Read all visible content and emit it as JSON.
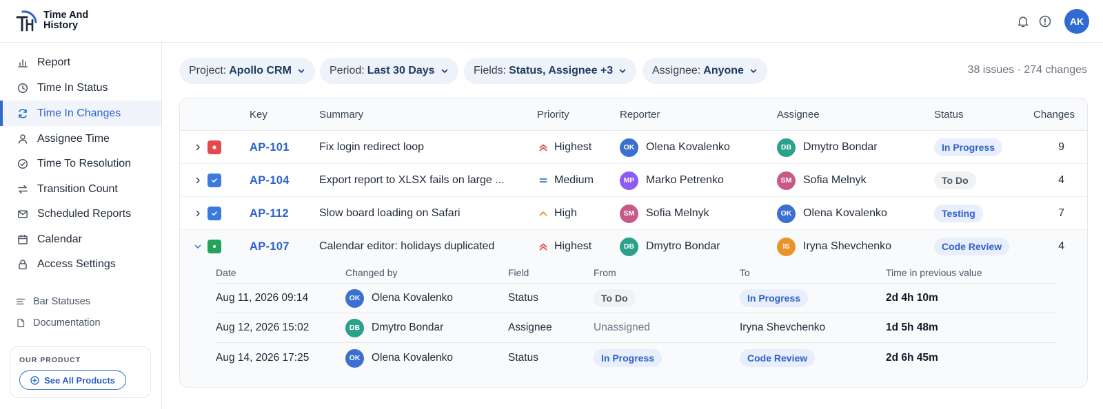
{
  "app": {
    "name": "Time And History",
    "brand_line1": "Time And",
    "brand_line2": "History",
    "user_initials": "AK"
  },
  "sidebar": {
    "items": [
      {
        "label": "Report",
        "icon": "bar-chart-icon"
      },
      {
        "label": "Time In Status",
        "icon": "clock-icon"
      },
      {
        "label": "Time In Changes",
        "icon": "refresh-icon",
        "active": true
      },
      {
        "label": "Assignee Time",
        "icon": "user-icon"
      },
      {
        "label": "Time To Resolution",
        "icon": "check-circle-icon"
      },
      {
        "label": "Transition Count",
        "icon": "swap-arrows-icon"
      },
      {
        "label": "Scheduled Reports",
        "icon": "mail-icon"
      },
      {
        "label": "Calendar",
        "icon": "calendar-icon"
      },
      {
        "label": "Access Settings",
        "icon": "lock-icon"
      }
    ],
    "secondary": [
      {
        "label": "Bar Statuses",
        "icon": "lines-icon"
      },
      {
        "label": "Documentation",
        "icon": "document-icon"
      }
    ],
    "product": {
      "caption": "OUR PRODUCT",
      "button": "See All Products"
    }
  },
  "filters": {
    "project": {
      "label": "Project:",
      "value": "Apollo CRM"
    },
    "period": {
      "label": "Period:",
      "value": "Last 30 Days"
    },
    "fields": {
      "label": "Fields:",
      "value": "Status, Assignee +3"
    },
    "assignee": {
      "label": "Assignee:",
      "value": "Anyone"
    },
    "counts": "38 issues · 274 changes"
  },
  "table": {
    "headers": {
      "key": "Key",
      "summary": "Summary",
      "priority": "Priority",
      "reporter": "Reporter",
      "assignee": "Assignee",
      "status": "Status",
      "changes": "Changes"
    },
    "rows": [
      {
        "type": "bug",
        "key": "AP-101",
        "summary": "Fix login redirect loop",
        "priority": "Highest",
        "reporter": {
          "initials": "OK",
          "name": "Olena Kovalenko"
        },
        "assignee": {
          "initials": "DB",
          "name": "Dmytro Bondar"
        },
        "status": "In Progress",
        "changes": "9"
      },
      {
        "type": "task",
        "key": "AP-104",
        "summary": "Export report to XLSX fails on large ...",
        "priority": "Medium",
        "reporter": {
          "initials": "MP",
          "name": "Marko Petrenko"
        },
        "assignee": {
          "initials": "SM",
          "name": "Sofia Melnyk"
        },
        "status": "To Do",
        "changes": "4"
      },
      {
        "type": "task",
        "key": "AP-112",
        "summary": "Slow board loading on Safari",
        "priority": "High",
        "reporter": {
          "initials": "SM",
          "name": "Sofia Melnyk"
        },
        "assignee": {
          "initials": "OK",
          "name": "Olena Kovalenko"
        },
        "status": "Testing",
        "changes": "7"
      },
      {
        "type": "story",
        "key": "AP-107",
        "summary": "Calendar editor: holidays duplicated",
        "priority": "Highest",
        "reporter": {
          "initials": "DB",
          "name": "Dmytro Bondar"
        },
        "assignee": {
          "initials": "IS",
          "name": "Iryna Shevchenko"
        },
        "status": "Code Review",
        "changes": "4"
      }
    ]
  },
  "changes": {
    "headers": {
      "date": "Date",
      "changed_by": "Changed by",
      "field": "Field",
      "from": "From",
      "to": "To",
      "time_prev": "Time in previous value"
    },
    "rows": [
      {
        "date": "Aug 11, 2026 09:14",
        "by": {
          "initials": "OK",
          "name": "Olena Kovalenko"
        },
        "field": "Status",
        "from": "To Do",
        "to": "In Progress",
        "time": "2d 4h 10m"
      },
      {
        "date": "Aug 12, 2026 15:02",
        "by": {
          "initials": "DB",
          "name": "Dmytro Bondar"
        },
        "field": "Assignee",
        "from": "Unassigned",
        "to": "Iryna Shevchenko",
        "time": "1d 5h 48m"
      },
      {
        "date": "Aug 14, 2026 17:25",
        "by": {
          "initials": "OK",
          "name": "Olena Kovalenko"
        },
        "field": "Status",
        "from": "In Progress",
        "to": "Code Review",
        "time": "2d 6h 45m"
      }
    ]
  },
  "colors": {
    "accent": "#2f6bd0",
    "avatar_OK": "#3b6fd1",
    "avatar_DB": "#2aa18a",
    "avatar_MP": "#8b5cf6",
    "avatar_SM": "#c85a8a",
    "avatar_IS": "#e8942a",
    "priority_highest": "#e04848",
    "priority_high": "#f08a24",
    "priority_medium": "#3b6fd1"
  }
}
